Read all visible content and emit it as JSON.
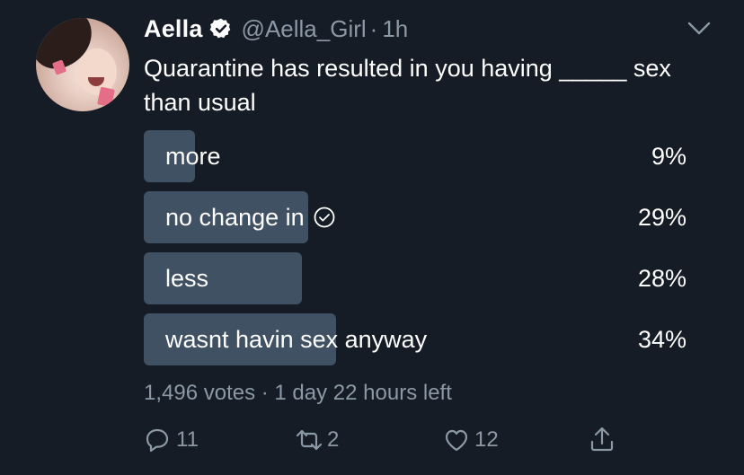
{
  "tweet": {
    "display_name": "Aella",
    "handle": "@Aella_Girl",
    "separator": "·",
    "time": "1h",
    "text": "Quarantine has resulted in you having _____ sex than usual"
  },
  "poll": {
    "options": [
      {
        "label": "more",
        "percent_text": "9%",
        "percent": 9,
        "voted": false
      },
      {
        "label": "no change in",
        "percent_text": "29%",
        "percent": 29,
        "voted": true
      },
      {
        "label": "less",
        "percent_text": "28%",
        "percent": 28,
        "voted": false
      },
      {
        "label": "wasnt havin sex anyway",
        "percent_text": "34%",
        "percent": 34,
        "voted": false
      }
    ],
    "meta": "1,496 votes · 1 day 22 hours left"
  },
  "actions": {
    "reply_count": "11",
    "retweet_count": "2",
    "like_count": "12"
  },
  "colors": {
    "background": "#161c26",
    "bar": "#3f5162",
    "muted": "#8b98a5"
  },
  "icons": [
    "verified-badge-icon",
    "chevron-down-icon",
    "check-circle-icon",
    "reply-icon",
    "retweet-icon",
    "like-icon",
    "share-icon"
  ]
}
